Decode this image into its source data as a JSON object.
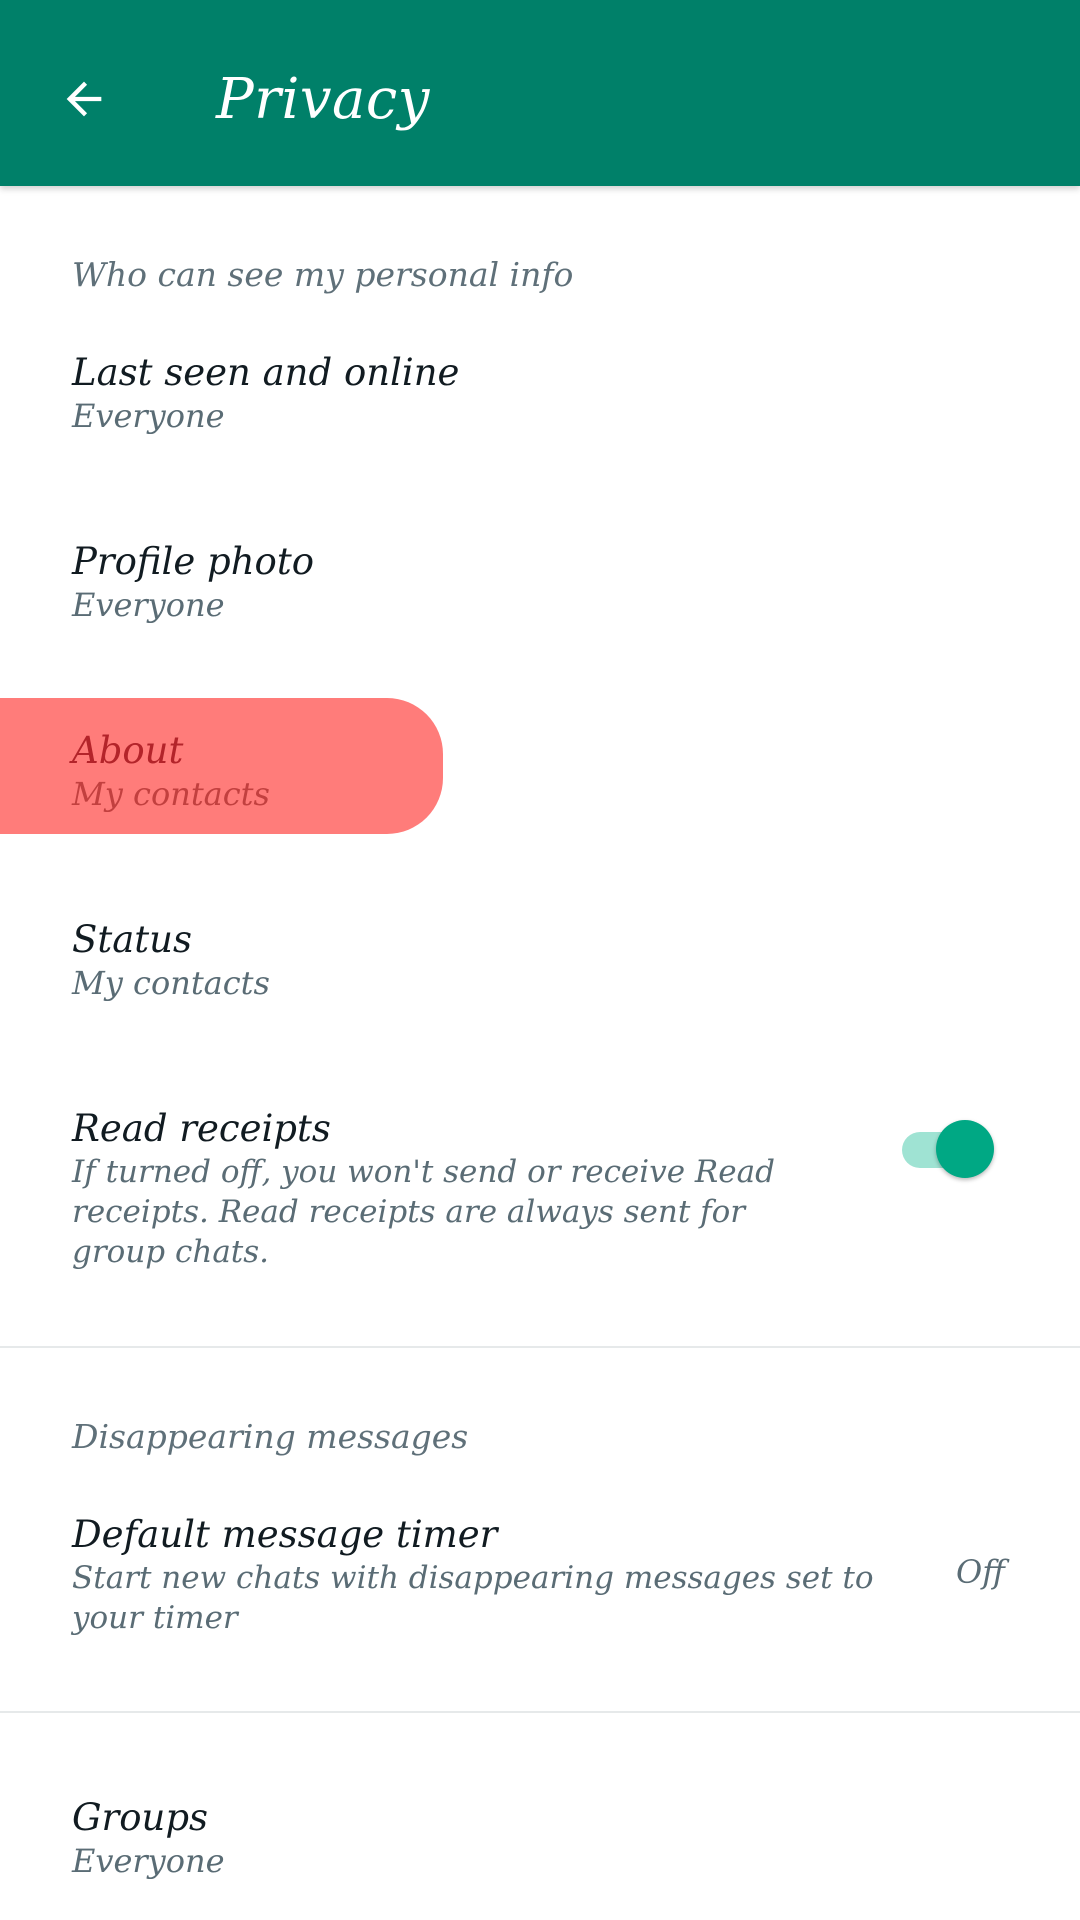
{
  "appbar": {
    "title": "Privacy",
    "background": "#008069",
    "back_icon": "arrow-left-icon"
  },
  "personal_info": {
    "header": "Who can see my personal info",
    "items": [
      {
        "label": "Last seen and online",
        "value": "Everyone"
      },
      {
        "label": "Profile photo",
        "value": "Everyone"
      },
      {
        "label": "About",
        "value": "My contacts",
        "highlighted": true
      },
      {
        "label": "Status",
        "value": "My contacts"
      }
    ]
  },
  "read_receipts": {
    "label": "Read receipts",
    "description": "If turned off, you won't send or receive Read receipts. Read receipts are always sent for group chats.",
    "enabled": true,
    "accent": "#00a884"
  },
  "disappearing": {
    "header": "Disappearing messages",
    "timer_label": "Default message timer",
    "timer_description": "Start new chats with disappearing messages set to your timer",
    "timer_value": "Off"
  },
  "groups": {
    "label": "Groups",
    "value": "Everyone"
  },
  "highlight_color": "#ff7c7a"
}
